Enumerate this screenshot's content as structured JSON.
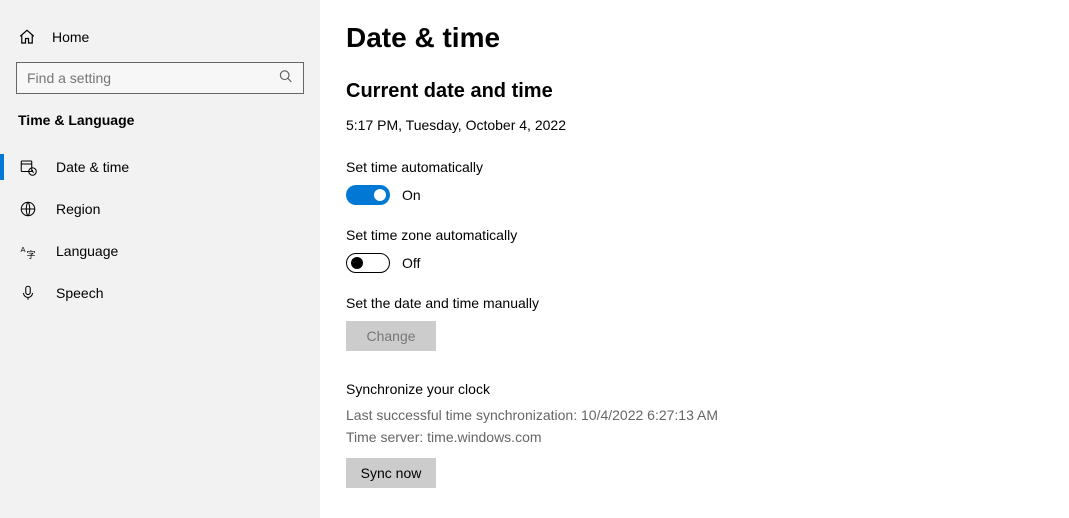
{
  "sidebar": {
    "home_label": "Home",
    "search_placeholder": "Find a setting",
    "category_title": "Time & Language",
    "items": [
      {
        "label": "Date & time"
      },
      {
        "label": "Region"
      },
      {
        "label": "Language"
      },
      {
        "label": "Speech"
      }
    ]
  },
  "content": {
    "heading": "Date & time",
    "section_title": "Current date and time",
    "current_datetime": "5:17 PM, Tuesday, October 4, 2022",
    "set_time_auto_label": "Set time automatically",
    "set_time_auto_state": "On",
    "set_tz_auto_label": "Set time zone automatically",
    "set_tz_auto_state": "Off",
    "manual_label": "Set the date and time manually",
    "change_btn": "Change",
    "sync_heading": "Synchronize your clock",
    "sync_last": "Last successful time synchronization: 10/4/2022 6:27:13 AM",
    "sync_server": "Time server: time.windows.com",
    "sync_btn": "Sync now"
  },
  "colors": {
    "accent": "#0078d4"
  }
}
